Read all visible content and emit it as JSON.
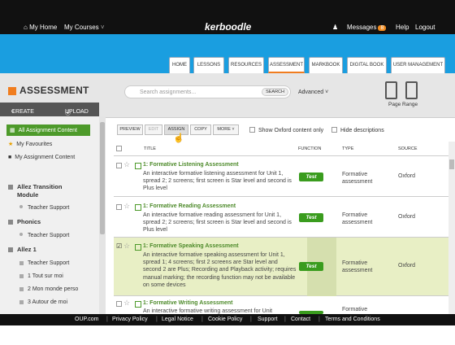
{
  "topbar": {
    "home": "My Home",
    "courses": "My Courses",
    "logo": "kerboodle",
    "messages": "Messages",
    "messages_count": "8",
    "help": "Help",
    "logout": "Logout"
  },
  "tabs": [
    "HOME",
    "LESSONS",
    "RESOURCES",
    "ASSESSMENT",
    "MARKBOOK",
    "DIGITAL BOOK",
    "USER MANAGEMENT"
  ],
  "page": {
    "title": "ASSESSMENT",
    "search_placeholder": "Search assignments...",
    "search_button": "SEARCH",
    "advanced": "Advanced",
    "page_range": "Page Range"
  },
  "create": {
    "create": "CREATE",
    "upload": "UPLOAD"
  },
  "sidebar": {
    "all": "All Assignment Content",
    "favourites": "My Favourites",
    "my_content": "My Assignment Content",
    "transition": "Allez Transition Module",
    "transition_support": "Teacher Support",
    "phonics": "Phonics",
    "phonics_support": "Teacher Support",
    "allez1": "Allez 1",
    "allez1_support": "Teacher Support",
    "unit1": "1 Tout sur moi",
    "unit2": "2 Mon monde perso",
    "unit3": "3 Autour de moi"
  },
  "toolbar": {
    "preview": "PREVIEW",
    "edit": "EDIT",
    "assign": "ASSIGN",
    "copy": "COPY",
    "more": "MORE",
    "show_oxford": "Show Oxford content only",
    "hide_desc": "Hide descriptions"
  },
  "table": {
    "headers": {
      "title": "TITLE",
      "function": "FUNCTION",
      "type": "TYPE",
      "source": "SOURCE"
    },
    "rows": [
      {
        "title": "1: Formative Listening Assessment",
        "desc": "An interactive formative listening assessment for Unit 1, spread 2; 2 screens; first screen is Star level and second is Plus level",
        "function": "Test",
        "type": "Formative assessment",
        "source": "Oxford"
      },
      {
        "title": "1: Formative Reading Assessment",
        "desc": "An interactive formative reading assessment for Unit 1, spread 2; 2 screens; first screen is Star level and second is Plus level",
        "function": "Test",
        "type": "Formative assessment",
        "source": "Oxford"
      },
      {
        "title": "1: Formative Speaking Assessment",
        "desc": "An interactive formative speaking assessment for Unit 1, spread 1; 4 screens; first 2 screens are Star level and second 2 are Plus; Recording and Playback activity; requires manual marking; the recording function may not be available on some devices",
        "function": "Test",
        "type": "Formative assessment",
        "source": "Oxford"
      },
      {
        "title": "1: Formative Writing Assessment",
        "desc": "An interactive formative writing assessment for Unit",
        "function": "Test",
        "type": "Formative",
        "source": "Oxford"
      }
    ]
  },
  "footer": [
    "OUP.com",
    "Privacy Policy",
    "Legal Notice",
    "Cookie Policy",
    "Support",
    "Contact",
    "Terms and Conditions"
  ],
  "colors": {
    "accent_orange": "#f07d1f",
    "brand_green": "#4d9a2a",
    "blue": "#1a9ee0"
  }
}
